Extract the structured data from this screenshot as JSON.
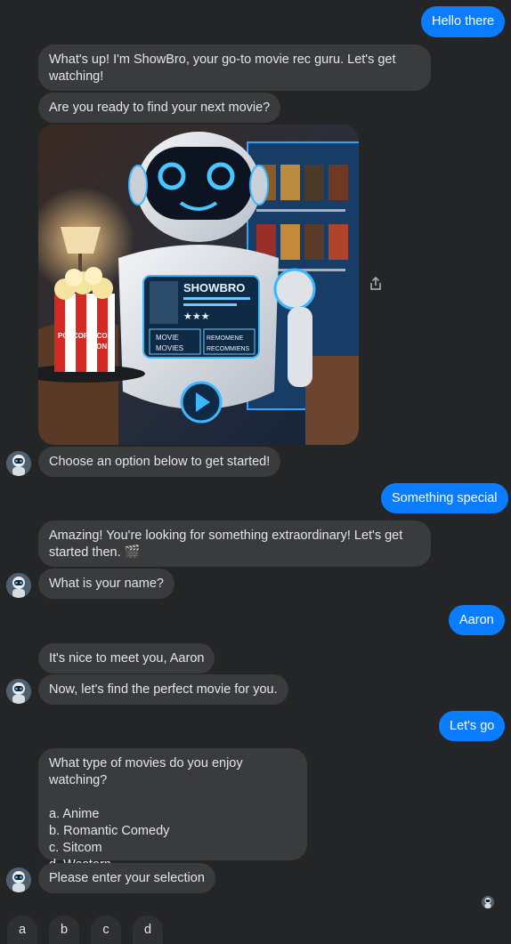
{
  "messages": {
    "user_hello": "Hello there",
    "bot_intro": "What's up! I'm ShowBro, your go-to movie rec guru. Let's get watching!",
    "bot_ready": "Are you ready to find your next movie?",
    "bot_choose": "Choose an option below to get started!",
    "user_special": "Something special",
    "bot_amazing": "Amazing! You're looking for something extraordinary! Let's get started then. 🎬",
    "bot_name_q": "What is your name?",
    "user_name": "Aaron",
    "bot_nice": "It's nice to meet you, Aaron",
    "bot_find": "Now, let's find the perfect movie for you.",
    "user_letsgo": "Let's go",
    "bot_types_q": "What type of movies do you enjoy watching?",
    "bot_options": [
      "a. Anime",
      "b. Romantic Comedy",
      "c. Sitcom",
      "d. Western"
    ],
    "bot_enter": "Please enter your selection"
  },
  "image": {
    "screen_title": "SHOWBRO",
    "screen_left_1": "MOVIE",
    "screen_left_2": "MOVIES",
    "screen_right_1": "REMOMENE",
    "screen_right_2": "RECOMMIENS",
    "popcorn_text_1": "POPCORN",
    "popcorn_text_2": "POCON",
    "popcorn_text_3": "PRON"
  },
  "quick_replies": [
    "a",
    "b",
    "c",
    "d"
  ],
  "colors": {
    "background": "#242526",
    "bot_bubble": "#3a3b3c",
    "user_bubble": "#0a7cff",
    "text": "#e4e6eb"
  },
  "icons": {
    "share": "share-icon",
    "avatar": "robot-avatar"
  }
}
